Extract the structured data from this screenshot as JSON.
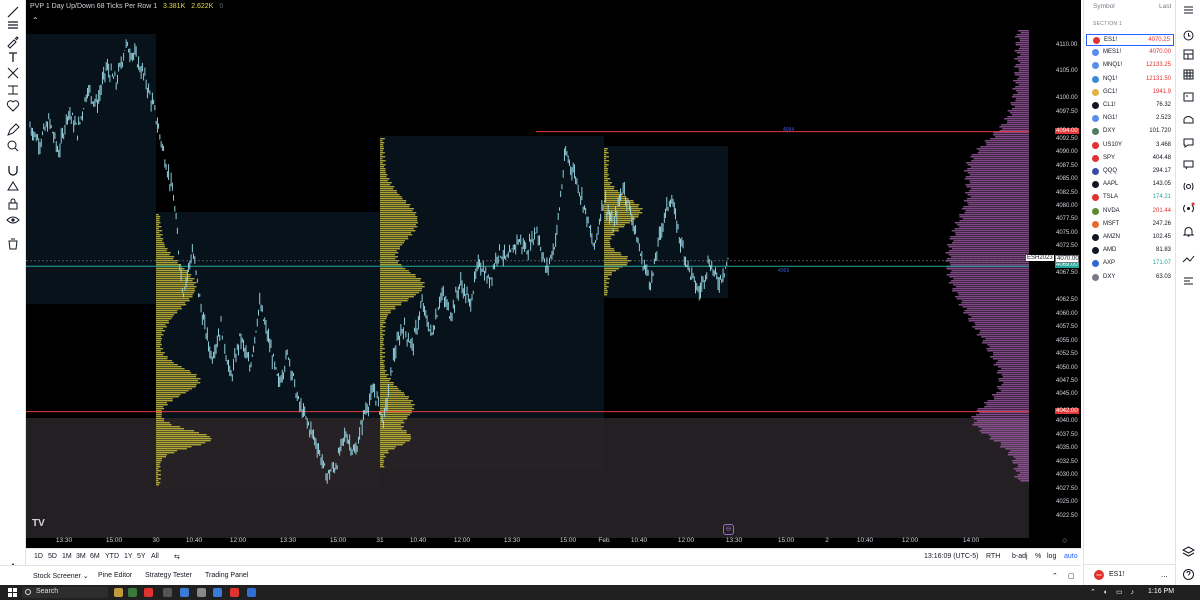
{
  "legend": {
    "title": "PVP 1 Day Up/Down 68 Ticks Per Row 1",
    "v1": "3.381K",
    "v2": "2.622K",
    "v3": "0"
  },
  "chart_data": {
    "type": "candlestick",
    "title": "PVP 1 Day Up/Down 68 Ticks Per Row 1",
    "ylim": [
      4020,
      4114
    ],
    "price_ticks": [
      "4110.00",
      "4105.00",
      "4100.00",
      "4097.50",
      "4092.50",
      "4090.00",
      "4087.50",
      "4085.00",
      "4082.50",
      "4080.00",
      "4077.50",
      "4075.00",
      "4072.50",
      "4067.50",
      "4062.50",
      "4060.00",
      "4057.50",
      "4055.00",
      "4052.50",
      "4050.00",
      "4047.50",
      "4045.00",
      "4040.00",
      "4037.50",
      "4035.00",
      "4032.50",
      "4030.00",
      "4027.50",
      "4025.00",
      "4022.50"
    ],
    "x_ticks": [
      "13:30",
      "15:00",
      "30",
      "10:40",
      "12:00",
      "13:30",
      "15:00",
      "31",
      "10:40",
      "12:00",
      "13:30",
      "15:00",
      "Feb",
      "10:40",
      "12:00",
      "13:30",
      "15:00",
      "2",
      "10:40",
      "12:00",
      "14:00"
    ],
    "horizontal_lines": [
      {
        "price": 4094.0,
        "label": "4094.00",
        "note": "4094",
        "color": "#e5383b"
      },
      {
        "price": 4042.0,
        "label": "4042.00",
        "color": "#e5383b"
      },
      {
        "price": 4069.0,
        "label": "4069.00",
        "note": "4069",
        "color": "#26a69a"
      }
    ],
    "current_price": {
      "symbol": "ESH2023",
      "price": "4070.00"
    },
    "price_path": [
      4095,
      4092,
      4096,
      4090,
      4098,
      4094,
      4102,
      4099,
      4106,
      4103,
      4110,
      4108,
      4104,
      4098,
      4090,
      4082,
      4064,
      4072,
      4060,
      4052,
      4058,
      4048,
      4056,
      4050,
      4062,
      4055,
      4047,
      4053,
      4044,
      4040,
      4036,
      4030,
      4032,
      4038,
      4034,
      4042,
      4046,
      4040,
      4052,
      4058,
      4054,
      4062,
      4056,
      4064,
      4060,
      4066,
      4062,
      4070,
      4066,
      4072,
      4070,
      4074,
      4072,
      4076,
      4068,
      4074,
      4090,
      4086,
      4080,
      4072,
      4082,
      4076,
      4084,
      4078,
      4070,
      4066,
      4076,
      4082,
      4074,
      4068,
      4064,
      4070,
      4066,
      4070
    ]
  },
  "x_axis_extra": {
    "tz": "13:16:09 (UTC-5)",
    "session": "RTH",
    "adj": "b-adj",
    "pct": "%",
    "log": "log",
    "auto": "auto"
  },
  "timeframes": [
    "1D",
    "5D",
    "1M",
    "3M",
    "6M",
    "YTD",
    "1Y",
    "5Y",
    "All"
  ],
  "panels": [
    "Stock Screener",
    "Pine Editor",
    "Strategy Tester",
    "Trading Panel"
  ],
  "watchlist": {
    "col_symbol": "Symbol",
    "col_last": "Last",
    "section": "SECTION 1",
    "items": [
      {
        "symbol": "ES1!",
        "last": "4070.25",
        "color": "#e0322f",
        "lastColor": "#e0322f"
      },
      {
        "symbol": "MES1!",
        "last": "4070.00",
        "color": "#5b8def",
        "lastColor": "#e0322f"
      },
      {
        "symbol": "MNQ1!",
        "last": "12133.25",
        "color": "#5b8def",
        "lastColor": "#e0322f"
      },
      {
        "symbol": "NQ1!",
        "last": "12131.50",
        "color": "#3d87d8",
        "lastColor": "#e0322f"
      },
      {
        "symbol": "GC1!",
        "last": "1941.9",
        "color": "#e3b341",
        "lastColor": "#e0322f"
      },
      {
        "symbol": "CL1!",
        "last": "76.32",
        "color": "#131722",
        "lastColor": "#131722"
      },
      {
        "symbol": "NG1!",
        "last": "2.523",
        "color": "#5b8def",
        "lastColor": "#131722"
      },
      {
        "symbol": "DXY",
        "last": "101.720",
        "color": "#4d7c5f",
        "lastColor": "#131722"
      },
      {
        "symbol": "US10Y",
        "last": "3.468",
        "color": "#e0322f",
        "lastColor": "#131722"
      },
      {
        "symbol": "SPY",
        "last": "404.48",
        "color": "#e0322f",
        "lastColor": "#131722"
      },
      {
        "symbol": "QQQ",
        "last": "294.17",
        "color": "#3a4ca8",
        "lastColor": "#131722"
      },
      {
        "symbol": "AAPL",
        "last": "143.05",
        "color": "#131722",
        "lastColor": "#131722"
      },
      {
        "symbol": "TSLA",
        "last": "174.21",
        "color": "#e0322f",
        "lastColor": "#26a69a"
      },
      {
        "symbol": "NVDA",
        "last": "201.44",
        "color": "#5a8a2b",
        "lastColor": "#e0322f"
      },
      {
        "symbol": "MSFT",
        "last": "247.26",
        "color": "#e86a2c",
        "lastColor": "#131722"
      },
      {
        "symbol": "AMZN",
        "last": "102.45",
        "color": "#131722",
        "lastColor": "#131722"
      },
      {
        "symbol": "AMD",
        "last": "81.83",
        "color": "#131722",
        "lastColor": "#131722"
      },
      {
        "symbol": "AXP",
        "last": "171.07",
        "color": "#2e6ad3",
        "lastColor": "#26a69a"
      },
      {
        "symbol": "DXY",
        "last": "63.03",
        "color": "#787b86",
        "lastColor": "#131722"
      }
    ],
    "bottom_symbol": "ES1!",
    "bottom_badge": "500",
    "bottom_more": "..."
  },
  "taskbar": {
    "search": "Search",
    "time": "1:16 PM"
  },
  "colors": {
    "up_volume": "#c9bd3a",
    "value_area": "#a05ca8",
    "candles": "#9fe0ee",
    "red_line": "#e5383b",
    "green_line": "#26a69a"
  }
}
